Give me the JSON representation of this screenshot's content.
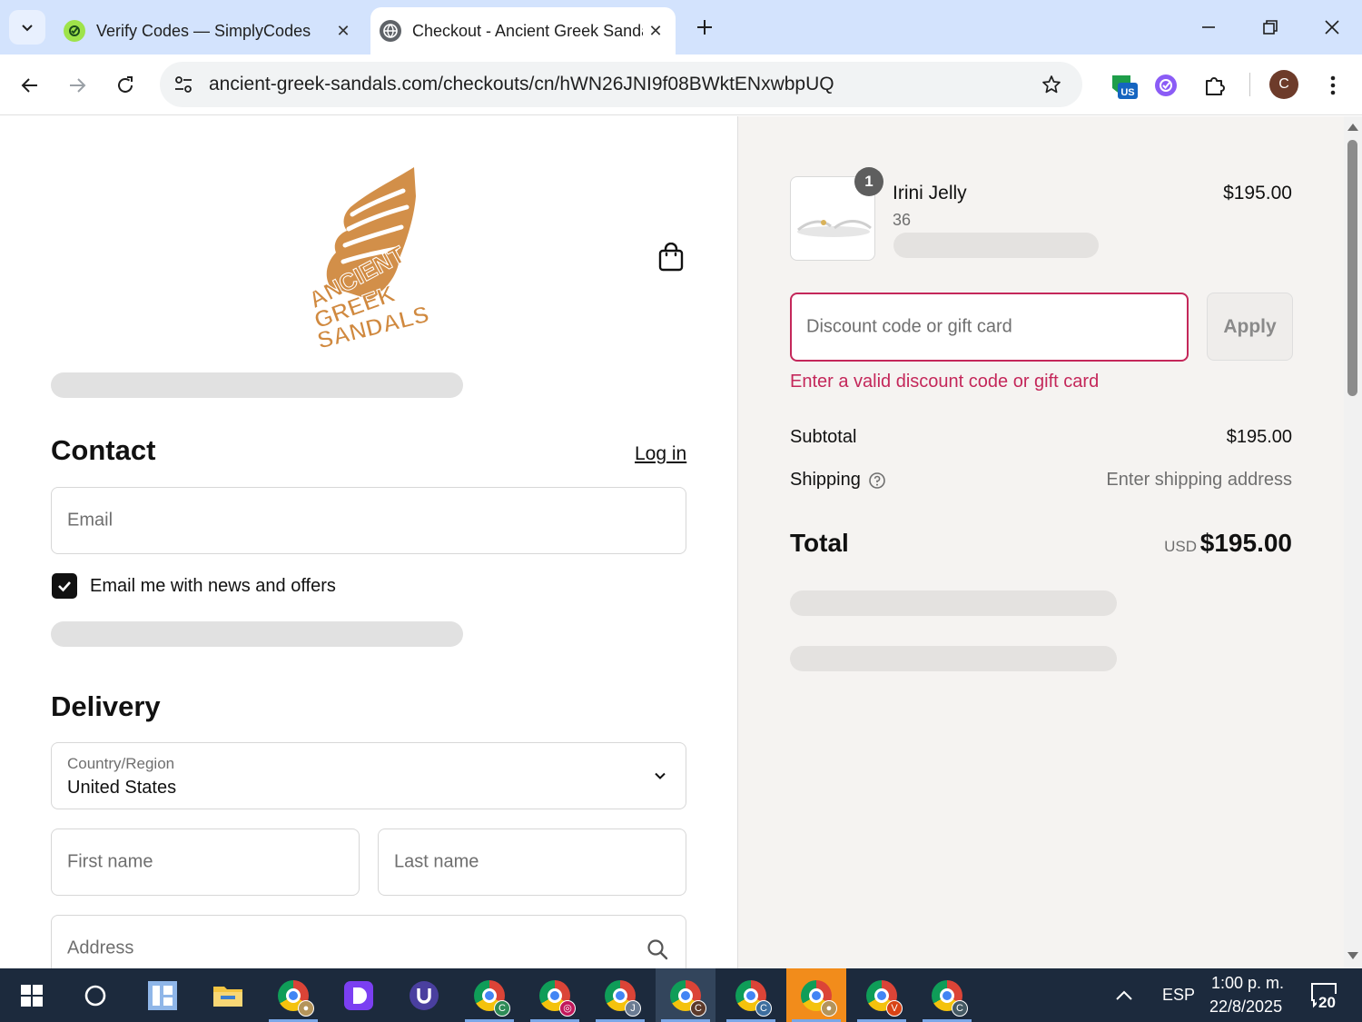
{
  "browser": {
    "tabs": [
      {
        "title": "Verify Codes — SimplyCodes",
        "active": false
      },
      {
        "title": "Checkout - Ancient Greek Sandals",
        "active": true
      }
    ],
    "url": "ancient-greek-sandals.com/checkouts/cn/hWN26JNI9f08BWktENxwbpUQ",
    "profile_initial": "C",
    "extension_badge": "US"
  },
  "store": {
    "logo_text": [
      "ANCIENT",
      "GREEK",
      "SANDALS"
    ]
  },
  "contact": {
    "heading": "Contact",
    "login_label": "Log in",
    "email_placeholder": "Email",
    "email_value": "",
    "news_checkbox_label": "Email me with news and offers",
    "news_checked": true
  },
  "delivery": {
    "heading": "Delivery",
    "country_label": "Country/Region",
    "country_value": "United States",
    "first_name_placeholder": "First name",
    "last_name_placeholder": "Last name",
    "address_placeholder": "Address"
  },
  "summary": {
    "item": {
      "name": "Irini Jelly",
      "variant": "36",
      "quantity": "1",
      "price": "$195.00"
    },
    "discount_placeholder": "Discount code or gift card",
    "apply_label": "Apply",
    "discount_error": "Enter a valid discount code or gift card",
    "subtotal_label": "Subtotal",
    "subtotal_value": "$195.00",
    "shipping_label": "Shipping",
    "shipping_value": "Enter shipping address",
    "total_label": "Total",
    "total_currency": "USD",
    "total_value": "$195.00"
  },
  "taskbar": {
    "language": "ESP",
    "time": "1:00 p. m.",
    "date": "22/8/2025",
    "notifications": "20",
    "chrome_badges": [
      "C",
      "C",
      "",
      "J",
      "C",
      "C",
      "",
      "V",
      "C"
    ]
  },
  "colors": {
    "tabstrip": "#d3e3fd",
    "summary_bg": "#f5f3f1",
    "error": "#c4275a",
    "logo": "#d0893f",
    "taskbar": "#1c2a3d"
  }
}
